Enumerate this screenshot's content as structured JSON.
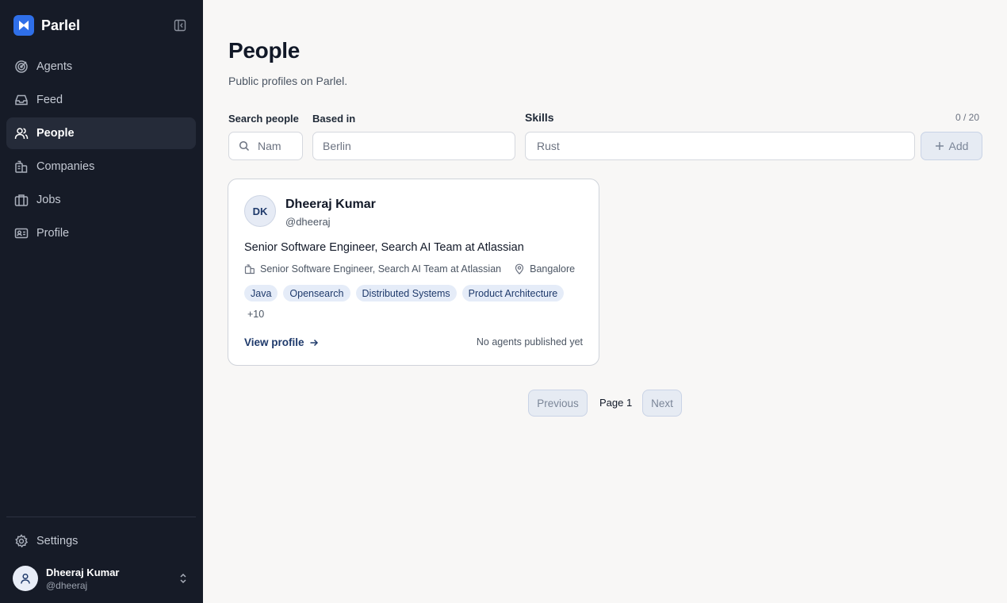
{
  "app": {
    "name": "Parlel",
    "brand_color": "#2f6fe8"
  },
  "sidebar": {
    "items": [
      {
        "label": "Agents",
        "icon": "radar-icon",
        "active": false
      },
      {
        "label": "Feed",
        "icon": "inbox-icon",
        "active": false
      },
      {
        "label": "People",
        "icon": "users-icon",
        "active": true
      },
      {
        "label": "Companies",
        "icon": "building-icon",
        "active": false
      },
      {
        "label": "Jobs",
        "icon": "briefcase-icon",
        "active": false
      },
      {
        "label": "Profile",
        "icon": "id-card-icon",
        "active": false
      }
    ],
    "settings_label": "Settings",
    "user": {
      "name": "Dheeraj Kumar",
      "handle": "@dheeraj"
    }
  },
  "page": {
    "title": "People",
    "subtitle": "Public profiles on Parlel."
  },
  "filters": {
    "search_label": "Search people",
    "search_placeholder": "Nam",
    "based_label": "Based in",
    "based_value": "Berlin",
    "skills_label": "Skills",
    "skills_value": "Rust",
    "skills_counter": "0 / 20",
    "add_label": "Add"
  },
  "results": [
    {
      "initials": "DK",
      "name": "Dheeraj Kumar",
      "handle": "@dheeraj",
      "headline": "Senior Software Engineer, Search AI Team at Atlassian",
      "position": "Senior Software Engineer, Search AI Team at Atlassian",
      "location": "Bangalore",
      "tags": [
        "Java",
        "Opensearch",
        "Distributed Systems",
        "Product Architecture"
      ],
      "more_tags": "+10",
      "view_profile_label": "View profile",
      "agents_status": "No agents published yet"
    }
  ],
  "pagination": {
    "previous_label": "Previous",
    "page_label": "Page 1",
    "next_label": "Next"
  }
}
